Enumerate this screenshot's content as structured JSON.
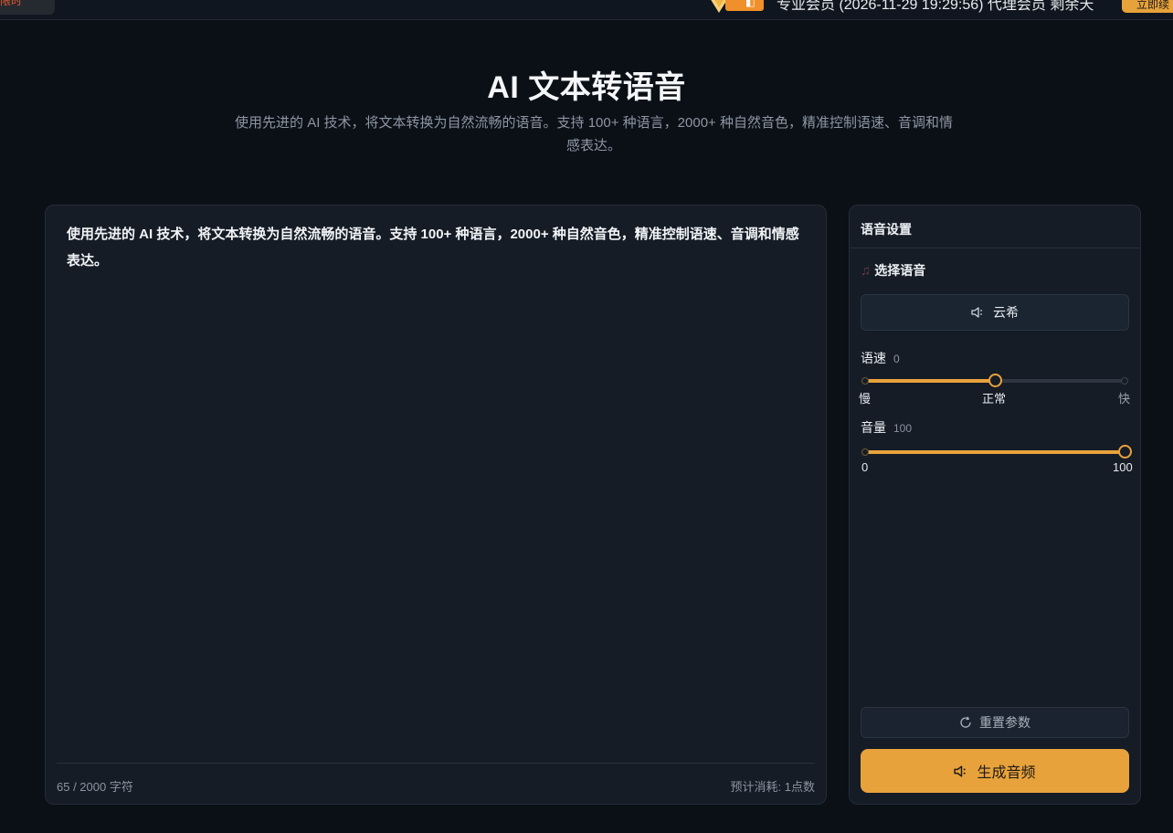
{
  "topbar": {
    "left_tag": "限时",
    "vip_text": "专业会员 (2026-11-29 19:29:56) 代理会员 剩余天",
    "right_button": "立即续"
  },
  "hero": {
    "title": "AI 文本转语音",
    "description": "使用先进的 AI 技术，将文本转换为自然流畅的语音。支持 100+ 种语言，2000+ 种自然音色，精准控制语速、音调和情感表达。"
  },
  "editor": {
    "text": "使用先进的 AI 技术，将文本转换为自然流畅的语音。支持 100+ 种语言，2000+ 种自然音色，精准控制语速、音调和情感表达。",
    "char_count": "65 / 2000 字符",
    "cost": "预计消耗: 1点数"
  },
  "settings": {
    "title": "语音设置",
    "voice_section_label": "选择语音",
    "voice_name": "云希",
    "speed": {
      "label": "语速",
      "value": "0",
      "fraction": 0.5,
      "min_label": "慢",
      "mid_label": "正常",
      "max_label": "快"
    },
    "volume": {
      "label": "音量",
      "value": "100",
      "fraction": 1.0,
      "min_label": "0",
      "max_label": "100"
    },
    "reset_label": "重置参数",
    "generate_label": "生成音频"
  },
  "colors": {
    "accent": "#e8a23c",
    "background": "#0b1017",
    "panel": "#151c26"
  }
}
